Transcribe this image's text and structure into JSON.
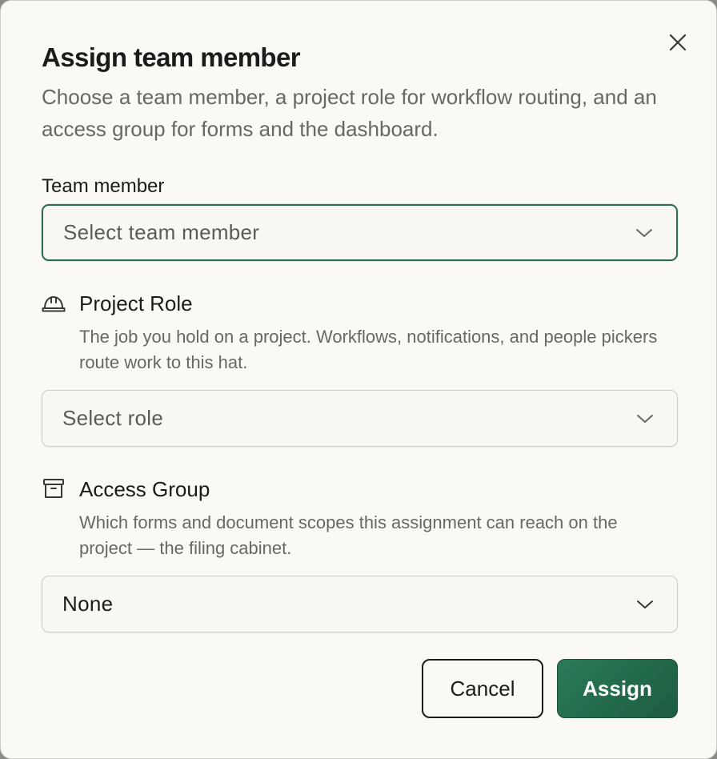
{
  "dialog": {
    "title": "Assign team member",
    "subtitle": "Choose a team member, a project role for workflow routing, and an access group for forms and the dashboard.",
    "close_icon": "close-icon"
  },
  "team_member": {
    "label": "Team member",
    "placeholder": "Select team member"
  },
  "project_role": {
    "icon": "hard-hat-icon",
    "title": "Project Role",
    "description": "The job you hold on a project. Workflows, notifications, and people pickers route work to this hat.",
    "placeholder": "Select role"
  },
  "access_group": {
    "icon": "archive-box-icon",
    "title": "Access Group",
    "description": "Which forms and document scopes this assignment can reach on the project — the filing cabinet.",
    "selected_value": "None"
  },
  "actions": {
    "cancel_label": "Cancel",
    "assign_label": "Assign"
  },
  "colors": {
    "accent": "#2a7a58",
    "focus_border": "#2f6b50",
    "text": "#1c1b19",
    "muted_text": "#6a6762",
    "background": "#faf9f6"
  }
}
